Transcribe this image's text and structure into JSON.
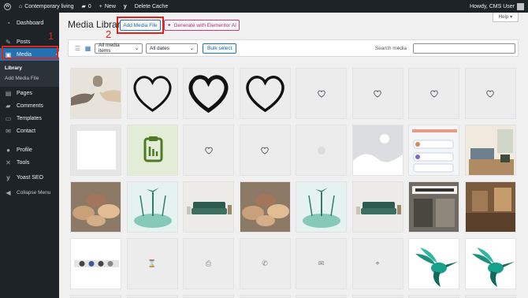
{
  "admin_bar": {
    "site_name": "Contemporary living",
    "comments_count": "0",
    "new_label": "New",
    "delete_cache_label": "Delete Cache",
    "howdy_label": "Howdy, CMS User"
  },
  "sidebar": {
    "dashboard": "Dashboard",
    "posts": "Posts",
    "media": "Media",
    "library": "Library",
    "add_media_file": "Add Media File",
    "pages": "Pages",
    "comments": "Comments",
    "templates": "Templates",
    "contact": "Contact",
    "profile": "Profile",
    "tools": "Tools",
    "yoast": "Yoast SEO",
    "collapse": "Collapse Menu"
  },
  "annotations": {
    "step1": "1",
    "step2": "2"
  },
  "header": {
    "title": "Media Library",
    "add_button": "Add Media File",
    "ai_button": "Generate with Elementor AI",
    "help_label": "Help"
  },
  "toolbar": {
    "filter_type": "All media items",
    "filter_date": "All dates",
    "bulk_select": "Bulk select",
    "search_label": "Search media",
    "search_value": ""
  },
  "colors": {
    "admin_dark": "#1d2327",
    "accent_blue": "#2271b1",
    "annotation_red": "#e0241b",
    "elementor_pink": "#d63384"
  },
  "tiles": [
    "hands-reaching-photo",
    "heart-outline-large",
    "heart-outline-bold",
    "heart-outline-medium",
    "heart-icon",
    "heart-icon",
    "heart-icon",
    "heart-icon",
    "white-square-image",
    "clipboard-icon-image",
    "heart-icon",
    "heart-icon",
    "blank-circle-placeholder",
    "image-placeholder",
    "screenshot-reviews",
    "living-room-photo",
    "hands-together-photo",
    "plant-hands-illustration",
    "green-sofa-photo",
    "hands-together-photo",
    "plant-hands-illustration",
    "green-sofa-photo",
    "shop-front-photo",
    "workshop-photo",
    "social-icons-strip",
    "hourglass-icon",
    "printer-icon",
    "phone-icon",
    "envelope-icon",
    "map-pin-icon",
    "hummingbird-illustration",
    "hummingbird-illustration",
    "partial",
    "partial",
    "partial",
    "partial",
    "partial",
    "partial",
    "partial",
    "partial"
  ]
}
